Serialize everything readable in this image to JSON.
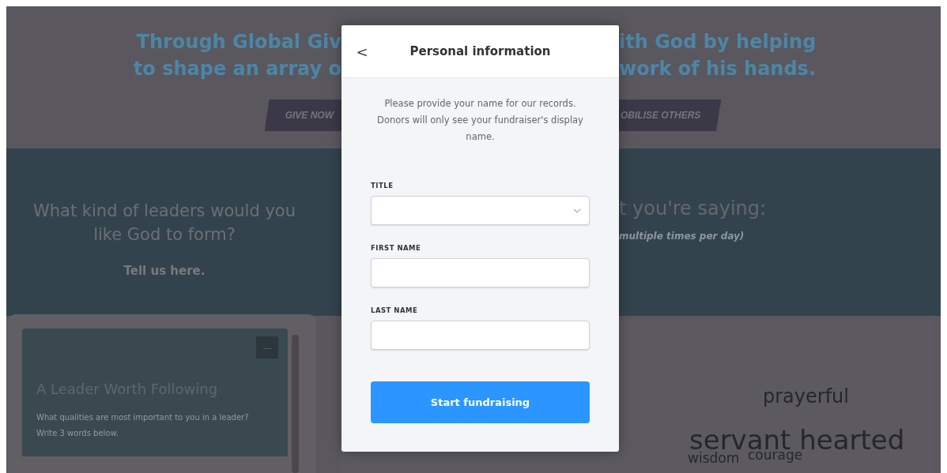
{
  "hero": {
    "headline_left": [
      "Through Global Giv",
      "to shape an array o"
    ],
    "headline_right": [
      "ith God by helping",
      "work of his hands."
    ],
    "buttons": [
      {
        "label": "GIVE NOW"
      },
      {
        "label": "OBILISE OTHERS"
      }
    ]
  },
  "prompt": {
    "question": "What kind of leaders would you like God to form?",
    "link": "Tell us here.",
    "responses_heading": "t you're saying:",
    "responses_note": "multiple times per day)"
  },
  "survey_card": {
    "title": "A Leader Worth Following",
    "text": "What qualities are most important to you in a leader? Write 3 words below.",
    "collapse_label": "—"
  },
  "word_cloud": [
    "prayerful",
    "servant hearted",
    "wisdom",
    "courage"
  ],
  "modal": {
    "back": "<",
    "title": "Personal information",
    "description": "Please provide your name for our records. Donors will only see your fundraiser's display name.",
    "fields": [
      {
        "label": "TITLE",
        "kind": "select"
      },
      {
        "label": "FIRST NAME",
        "kind": "text"
      },
      {
        "label": "LAST NAME",
        "kind": "text"
      }
    ],
    "submit": "Start fundraising"
  }
}
